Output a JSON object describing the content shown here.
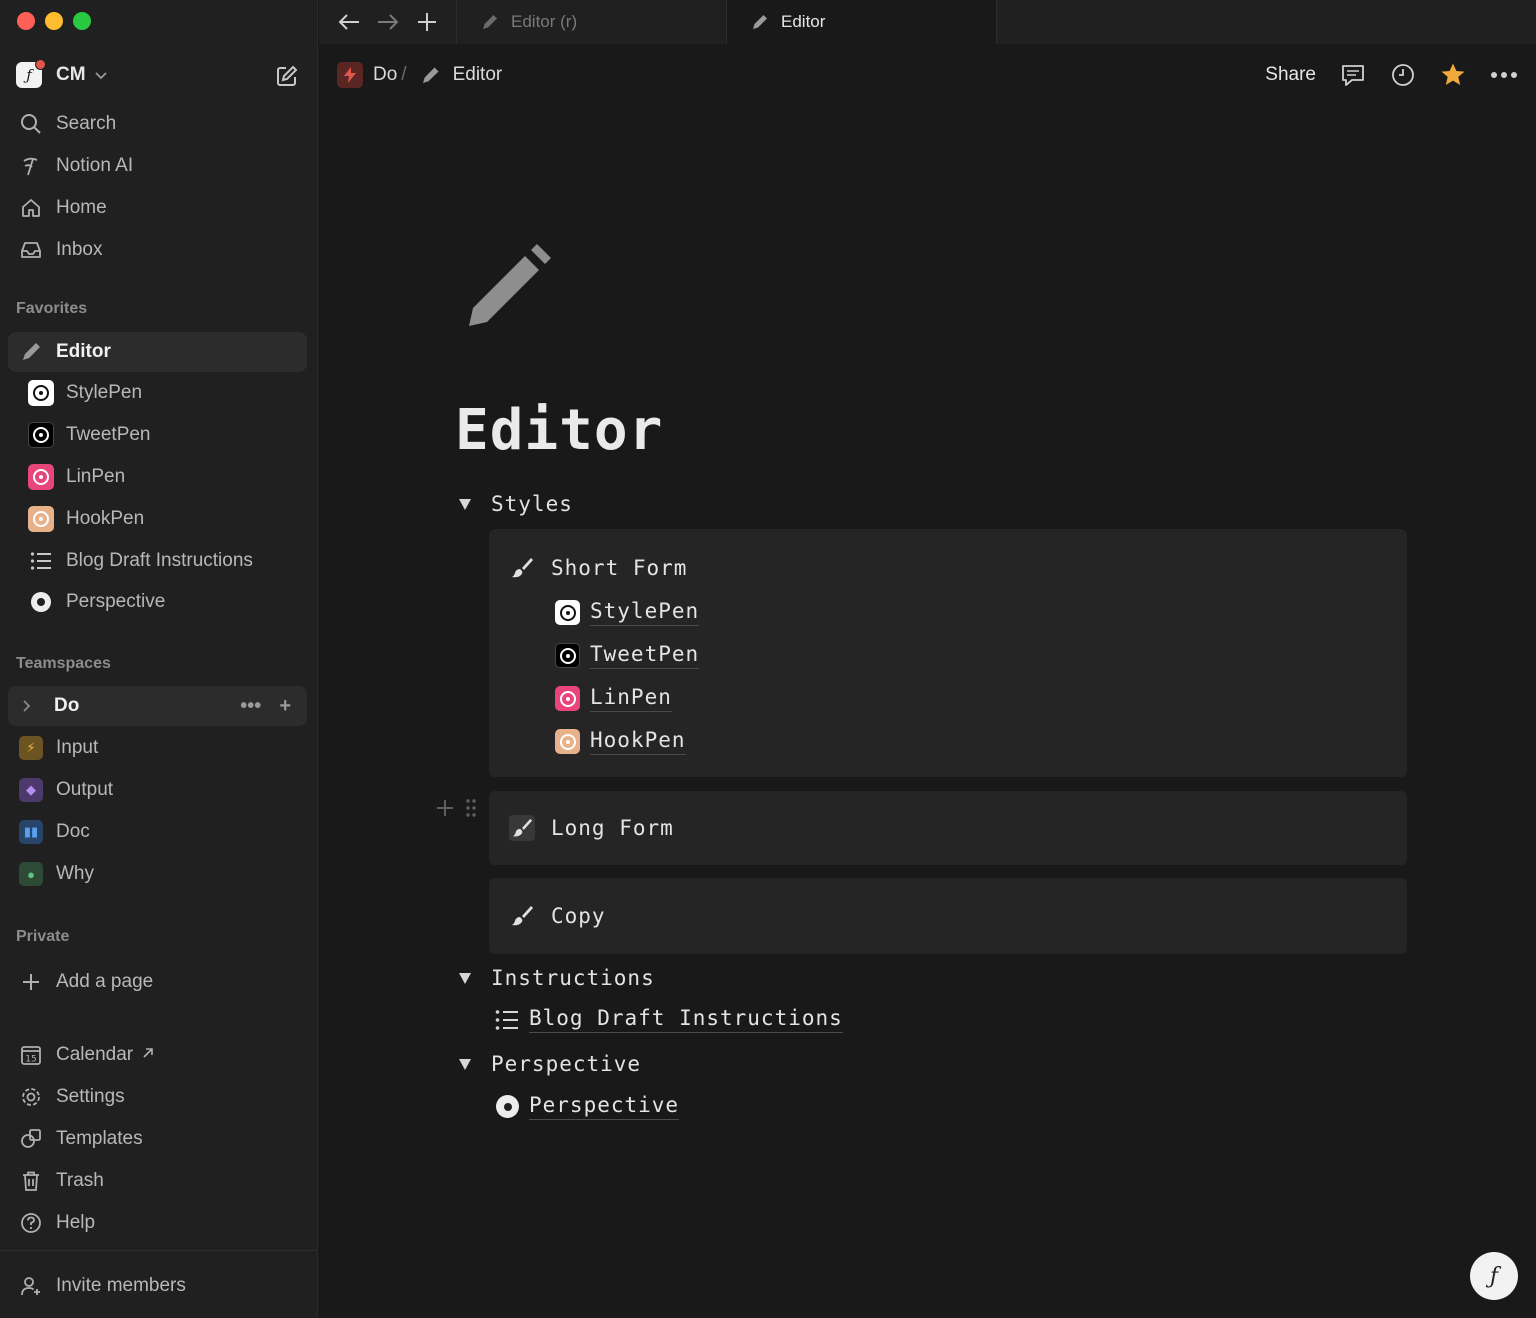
{
  "workspace": {
    "name": "CM",
    "logo_icon": "feather-logo-icon"
  },
  "sidebar": {
    "top_items": [
      {
        "label": "Search",
        "icon": "search-icon"
      },
      {
        "label": "Notion AI",
        "icon": "notion-ai-icon"
      },
      {
        "label": "Home",
        "icon": "home-icon"
      },
      {
        "label": "Inbox",
        "icon": "inbox-icon"
      }
    ],
    "favorites_label": "Favorites",
    "favorites": [
      {
        "label": "Editor",
        "icon": "pencil-icon",
        "active": true
      },
      {
        "label": "StylePen",
        "icon": "stylepen-icon"
      },
      {
        "label": "TweetPen",
        "icon": "tweetpen-icon"
      },
      {
        "label": "LinPen",
        "icon": "linpen-icon"
      },
      {
        "label": "HookPen",
        "icon": "hookpen-icon"
      },
      {
        "label": "Blog Draft Instructions",
        "icon": "list-icon"
      },
      {
        "label": "Perspective",
        "icon": "perspective-icon"
      }
    ],
    "teamspaces_label": "Teamspaces",
    "teamspaces": [
      {
        "label": "Do"
      },
      {
        "label": "Input",
        "icon": "input-icon"
      },
      {
        "label": "Output",
        "icon": "output-icon"
      },
      {
        "label": "Doc",
        "icon": "doc-icon"
      },
      {
        "label": "Why",
        "icon": "why-icon"
      }
    ],
    "private_label": "Private",
    "add_page_label": "Add a page",
    "bottom_items": [
      {
        "label": "Calendar",
        "icon": "calendar-icon",
        "calendar_day": "15"
      },
      {
        "label": "Settings",
        "icon": "gear-icon"
      },
      {
        "label": "Templates",
        "icon": "templates-icon"
      },
      {
        "label": "Trash",
        "icon": "trash-icon"
      },
      {
        "label": "Help",
        "icon": "help-icon"
      }
    ],
    "invite_label": "Invite members"
  },
  "tabs": [
    {
      "label": "Editor (r)"
    },
    {
      "label": "Editor"
    }
  ],
  "breadcrumb": {
    "parent": "Do",
    "separator": "/",
    "current": "Editor"
  },
  "topbar": {
    "share_label": "Share"
  },
  "page": {
    "title": "Editor",
    "sections": {
      "styles": {
        "label": "Styles",
        "short_form": {
          "title": "Short Form",
          "links": [
            "StylePen",
            "TweetPen",
            "LinPen",
            "HookPen"
          ]
        },
        "long_form": {
          "title": "Long Form"
        },
        "copy": {
          "title": "Copy"
        }
      },
      "instructions": {
        "label": "Instructions",
        "link": "Blog Draft Instructions"
      },
      "perspective": {
        "label": "Perspective",
        "link": "Perspective"
      }
    }
  },
  "colors": {
    "sidebar_bg": "#202020",
    "main_bg": "#191919",
    "callout_bg": "#252525",
    "favorite_star": "#f0a93a",
    "linpen_pink": "#e8457a",
    "hookpen_peach": "#e7b28a"
  }
}
